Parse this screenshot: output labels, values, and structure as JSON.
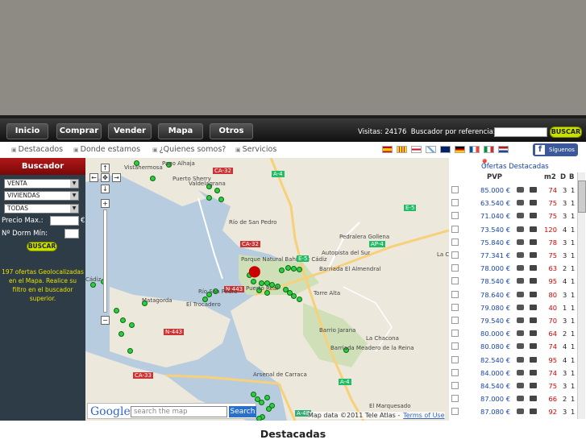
{
  "nav": {
    "items": [
      "Inicio",
      "Comprar",
      "Vender",
      "Mapa",
      "Otros"
    ],
    "visitas": "Visitas: 24176",
    "buscador_label": "Buscador por referencia:",
    "buscar": "BUSCAR"
  },
  "subnav": [
    "Destacados",
    "Donde estamos",
    "¿Quienes somos?",
    "Servicios"
  ],
  "facebook": "Síguenos",
  "sidebar": {
    "title": "Buscador",
    "select1": "VENTA",
    "select2": "VIVIENDAS",
    "select3": "TODAS",
    "precio": "Precio Max.:",
    "euro": "€",
    "dorm": "Nº Dorm Mín:",
    "buscar": "BUSCAR",
    "info": "197 ofertas Geolocalizadas en el Mapa. Realice su filtro en el buscador superior."
  },
  "map": {
    "search_placeholder": "search the map",
    "search_btn": "Search",
    "google": "Google",
    "data": "Map data ©2011 Tele Atlas -",
    "terms": "Terms of Use",
    "labels": [
      "Vistahermosa",
      "Pago Alhaja",
      "Puerto Sherry",
      "Valdelagrana",
      "CA-32",
      "A-4",
      "Río de San Pedro",
      "CA-32",
      "E-5",
      "Pedralera Gollena",
      "AP-4",
      "La C",
      "Parque Natural Bahía de Cádiz",
      "E-5",
      "Autopista del Sur",
      "Barriada El Almendral",
      "Torre Alta",
      "N-443",
      "Puerto Real",
      "Río San Pedro",
      "Matagorda",
      "El Trocadero",
      "N-443",
      "Barrio Jarana",
      "La Chacona",
      "Barriada Meadero de la Reina",
      "A-4",
      "CA-33",
      "Arsenal de Carraca",
      "El Marquesado",
      "A-48",
      "Cádiz"
    ]
  },
  "list": {
    "title": "Ofertas Destacadas",
    "col_pvp": "PVP",
    "col_m2": "m2",
    "col_d": "D",
    "col_b": "B",
    "rows": [
      {
        "price": "85.000 €",
        "m2": "74",
        "d": "3",
        "b": "1"
      },
      {
        "price": "63.540 €",
        "m2": "75",
        "d": "3",
        "b": "1"
      },
      {
        "price": "71.040 €",
        "m2": "75",
        "d": "3",
        "b": "1"
      },
      {
        "price": "73.540 €",
        "m2": "120",
        "d": "4",
        "b": "1"
      },
      {
        "price": "75.840 €",
        "m2": "78",
        "d": "3",
        "b": "1"
      },
      {
        "price": "77.341 €",
        "m2": "75",
        "d": "3",
        "b": "1"
      },
      {
        "price": "78.000 €",
        "m2": "63",
        "d": "2",
        "b": "1"
      },
      {
        "price": "78.540 €",
        "m2": "95",
        "d": "4",
        "b": "1"
      },
      {
        "price": "78.640 €",
        "m2": "80",
        "d": "3",
        "b": "1"
      },
      {
        "price": "79.080 €",
        "m2": "40",
        "d": "1",
        "b": "1"
      },
      {
        "price": "79.540 €",
        "m2": "70",
        "d": "3",
        "b": "1"
      },
      {
        "price": "80.000 €",
        "m2": "64",
        "d": "2",
        "b": "1"
      },
      {
        "price": "80.080 €",
        "m2": "74",
        "d": "4",
        "b": "1"
      },
      {
        "price": "82.540 €",
        "m2": "95",
        "d": "4",
        "b": "1"
      },
      {
        "price": "84.000 €",
        "m2": "74",
        "d": "3",
        "b": "1"
      },
      {
        "price": "84.540 €",
        "m2": "75",
        "d": "3",
        "b": "1"
      },
      {
        "price": "87.000 €",
        "m2": "66",
        "d": "2",
        "b": "1"
      },
      {
        "price": "87.080 €",
        "m2": "92",
        "d": "3",
        "b": "1"
      }
    ]
  },
  "footer": "Destacadas"
}
